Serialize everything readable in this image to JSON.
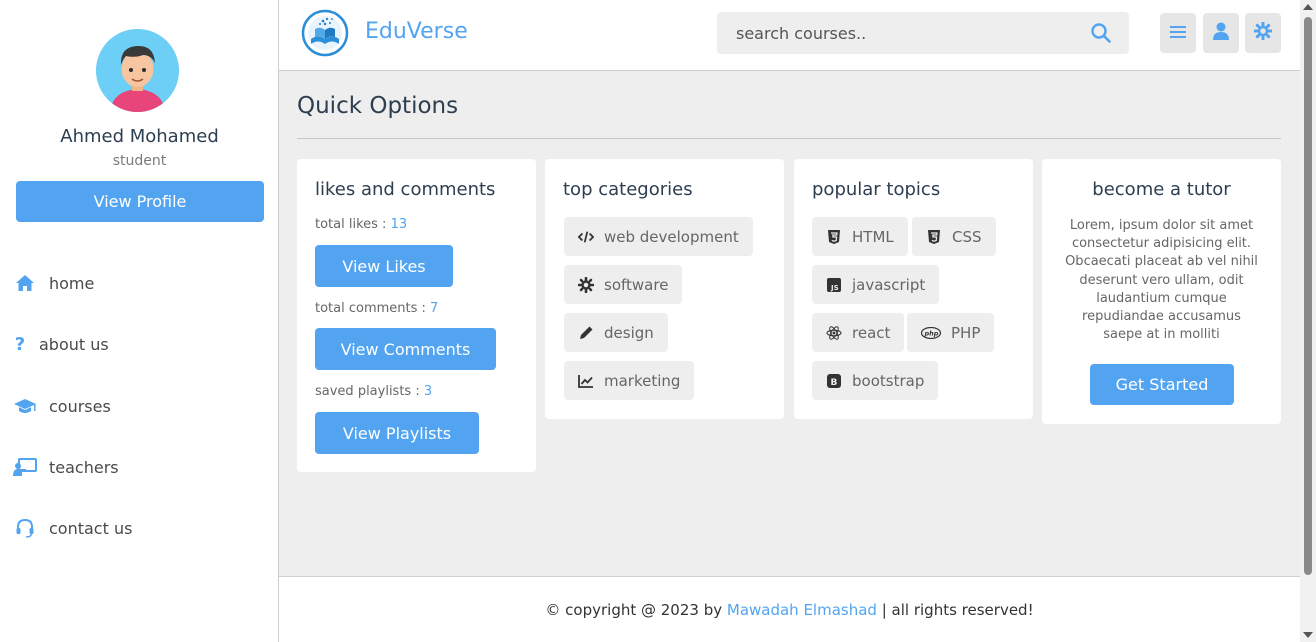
{
  "sidebar": {
    "user_name": "Ahmed Mohamed",
    "user_role": "student",
    "profile_button": "View Profile",
    "nav": [
      {
        "label": "home",
        "icon": "home-icon"
      },
      {
        "label": "about us",
        "icon": "question-icon"
      },
      {
        "label": "courses",
        "icon": "graduation-cap-icon"
      },
      {
        "label": "teachers",
        "icon": "chalkboard-teacher-icon"
      },
      {
        "label": "contact us",
        "icon": "headset-icon"
      }
    ]
  },
  "header": {
    "brand": "EduVerse",
    "search_placeholder": "search courses..",
    "buttons": [
      "menu-icon",
      "user-icon",
      "settings-icon"
    ]
  },
  "main": {
    "title": "Quick Options",
    "likes_card": {
      "title": "likes and comments",
      "likes_label": "total likes : ",
      "likes_value": "13",
      "likes_button": "View Likes",
      "comments_label": "total comments : ",
      "comments_value": "7",
      "comments_button": "View Comments",
      "playlists_label": "saved playlists : ",
      "playlists_value": "3",
      "playlists_button": "View Playlists"
    },
    "categories_card": {
      "title": "top categories",
      "tags": [
        {
          "label": "web development",
          "icon": "code-icon"
        },
        {
          "label": "software",
          "icon": "gear-icon"
        },
        {
          "label": "design",
          "icon": "pen-icon"
        },
        {
          "label": "marketing",
          "icon": "chart-line-icon"
        }
      ]
    },
    "topics_card": {
      "title": "popular topics",
      "tags": [
        {
          "label": "HTML",
          "icon": "html5-icon"
        },
        {
          "label": "CSS",
          "icon": "css3-icon"
        },
        {
          "label": "javascript",
          "icon": "js-icon"
        },
        {
          "label": "react",
          "icon": "react-icon"
        },
        {
          "label": "PHP",
          "icon": "php-icon"
        },
        {
          "label": "bootstrap",
          "icon": "bootstrap-icon"
        }
      ]
    },
    "tutor_card": {
      "title": "become a tutor",
      "text": "Lorem, ipsum dolor sit amet consectetur adipisicing elit. Obcaecati placeat ab vel nihil deserunt vero ullam, odit laudantium cumque repudiandae accusamus saepe at in molliti",
      "button": "Get Started"
    }
  },
  "footer": {
    "prefix": "© copyright @ 2023 by ",
    "author": "Mawadah Elmashad",
    "suffix": " | all rights reserved!"
  },
  "colors": {
    "accent": "#52a4f1",
    "background": "#eeeeee",
    "text": "#2c3e50"
  }
}
